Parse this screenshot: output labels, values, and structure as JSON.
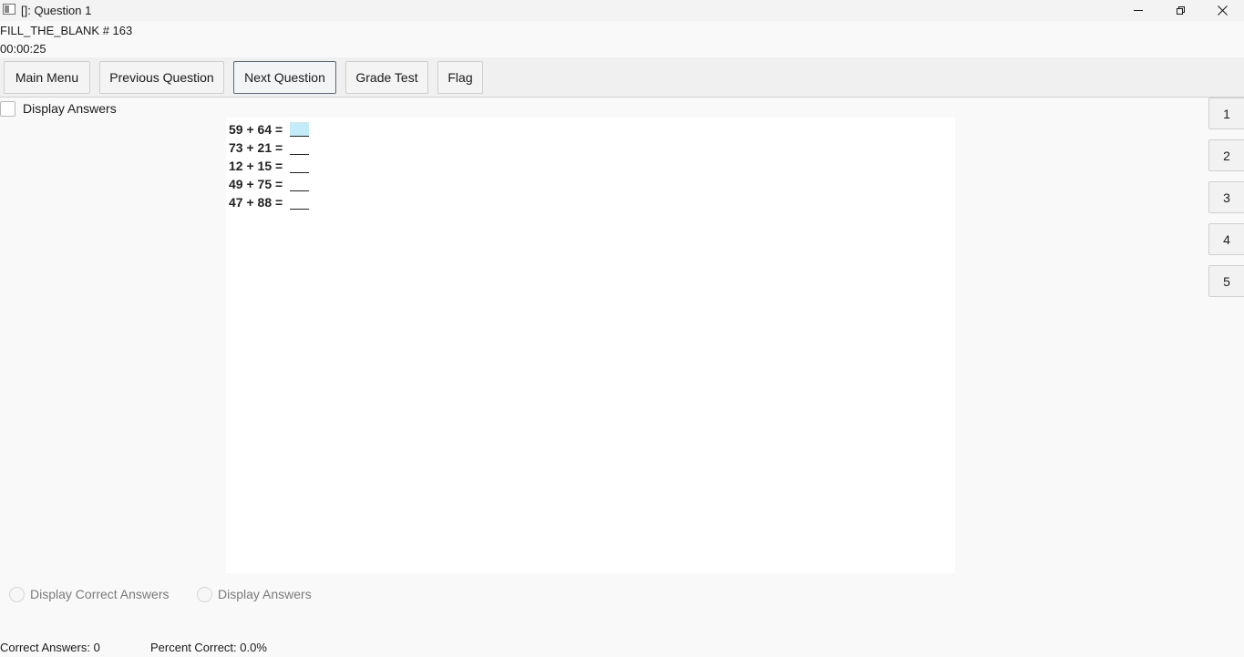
{
  "window": {
    "title": "[]: Question 1",
    "icon": "app-window-icon"
  },
  "question_info": {
    "type_label": "FILL_THE_BLANK # 163",
    "elapsed_time": "00:00:25"
  },
  "toolbar": {
    "main_menu": "Main Menu",
    "previous_question": "Previous Question",
    "next_question": "Next Question",
    "grade_test": "Grade Test",
    "flag": "Flag"
  },
  "display_answers_checkbox": {
    "label": "Display Answers",
    "checked": false
  },
  "equations": [
    {
      "text": "59 + 64 = ",
      "blank": "",
      "focused": true
    },
    {
      "text": "73 + 21 = ",
      "blank": "",
      "focused": false
    },
    {
      "text": "12 + 15 = ",
      "blank": "",
      "focused": false
    },
    {
      "text": "49 + 75 = ",
      "blank": "",
      "focused": false
    },
    {
      "text": "47 + 88 = ",
      "blank": "",
      "focused": false
    }
  ],
  "question_nav": [
    "1",
    "2",
    "3",
    "4",
    "5"
  ],
  "answer_display_options": {
    "correct_answers": "Display Correct Answers",
    "answers": "Display Answers"
  },
  "status": {
    "correct_answers": "Correct Answers: 0",
    "percent_correct": "Percent Correct: 0.0%"
  },
  "colors": {
    "focused_blank": "#c4ecf8",
    "toolbar_bg": "#f0f0f0",
    "content_bg": "#ffffff"
  }
}
